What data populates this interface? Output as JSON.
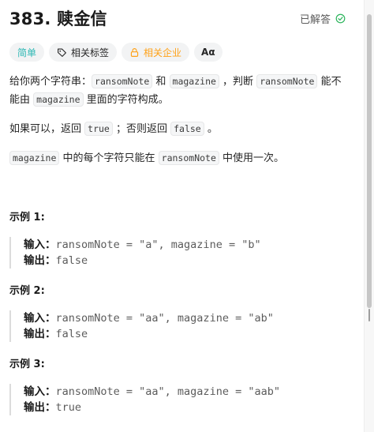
{
  "problem": {
    "title": "383. 赎金信",
    "status": "已解答"
  },
  "tags": {
    "difficulty": "简单",
    "related_tags": "相关标签",
    "companies": "相关企业",
    "translate": "Aα"
  },
  "description": {
    "p1_a": "给你两个字符串：",
    "p1_code1": "ransomNote",
    "p1_b": " 和 ",
    "p1_code2": "magazine",
    "p1_c": " ，判断 ",
    "p1_code3": "ransomNote",
    "p1_d": " 能不能由 ",
    "p1_code4": "magazine",
    "p1_e": " 里面的字符构成。",
    "p2_a": "如果可以，返回 ",
    "p2_code1": "true",
    "p2_b": " ；否则返回 ",
    "p2_code2": "false",
    "p2_c": " 。",
    "p3_code": "magazine",
    "p3_a": " 中的每个字符只能在 ",
    "p3_code2": "ransomNote",
    "p3_b": " 中使用一次。"
  },
  "examples": [
    {
      "title": "示例 1:",
      "input_label": "输入：",
      "input": "ransomNote = \"a\", magazine = \"b\"",
      "output_label": "输出：",
      "output": "false"
    },
    {
      "title": "示例 2:",
      "input_label": "输入：",
      "input": "ransomNote = \"aa\", magazine = \"ab\"",
      "output_label": "输出：",
      "output": "false"
    },
    {
      "title": "示例 3:",
      "input_label": "输入：",
      "input": "ransomNote = \"aa\", magazine = \"aab\"",
      "output_label": "输出：",
      "output": "true"
    }
  ],
  "colors": {
    "easy": "#2db7b4",
    "company": "#ffa116",
    "solved_check": "#2db55d"
  }
}
